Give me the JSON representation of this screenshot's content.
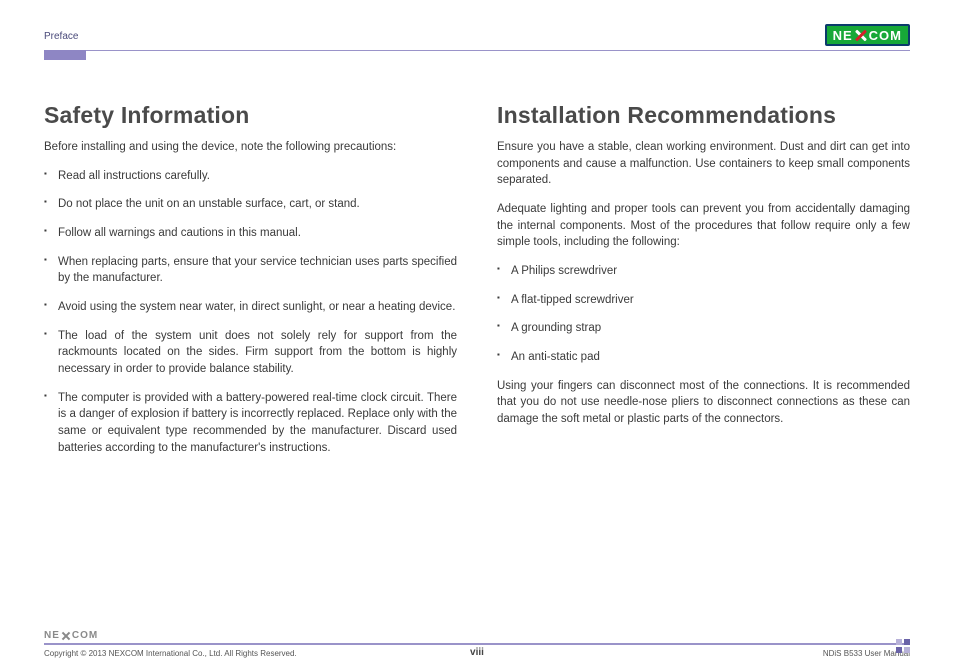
{
  "header": {
    "section": "Preface",
    "logo_text_left": "NE",
    "logo_text_right": "COM"
  },
  "left": {
    "heading": "Safety Information",
    "intro": "Before installing and using the device, note the following precautions:",
    "items": [
      "Read all instructions carefully.",
      "Do not place the unit on an unstable surface, cart, or stand.",
      "Follow all warnings and cautions in this manual.",
      "When replacing parts, ensure that your service technician uses parts specified by the manufacturer.",
      "Avoid using the system near water, in direct sunlight, or near a heating device.",
      "The load of the system unit does not solely rely for support from the rackmounts located on the sides. Firm support from the bottom is highly necessary in order to provide balance stability.",
      "The computer is provided with a battery-powered real-time clock circuit. There is a danger of explosion if battery is incorrectly replaced. Replace only with the same or equivalent type recommended by the manufacturer. Discard used batteries according to the manufacturer's instructions."
    ]
  },
  "right": {
    "heading": "Installation Recommendations",
    "p1": "Ensure you have a stable, clean working environment. Dust and dirt can get into components and cause a malfunction. Use containers to keep small components separated.",
    "p2": "Adequate lighting and proper tools can prevent you from accidentally damaging the internal components. Most of the procedures that follow require only a few simple tools, including the following:",
    "items": [
      "A Philips screwdriver",
      "A flat-tipped screwdriver",
      "A grounding strap",
      "An anti-static pad"
    ],
    "p3": "Using your fingers can disconnect most of the connections. It is recommended that you do not use needle-nose pliers to disconnect connections as these can damage the soft metal or plastic parts of the connectors."
  },
  "footer": {
    "copyright": "Copyright © 2013 NEXCOM International Co., Ltd. All Rights Reserved.",
    "page": "viii",
    "manual": "NDiS B533 User Manual",
    "logo_left": "NE",
    "logo_right": "COM"
  }
}
